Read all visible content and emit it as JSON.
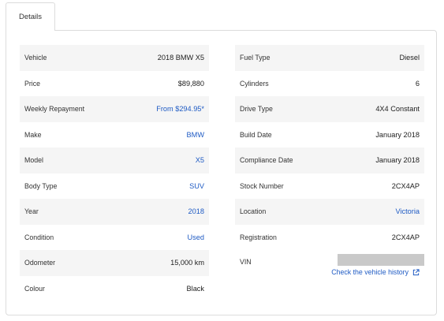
{
  "tab": {
    "label": "Details"
  },
  "left_rows": [
    {
      "label": "Vehicle",
      "value": "2018 BMW X5",
      "link": false
    },
    {
      "label": "Price",
      "value": "$89,880",
      "link": false
    },
    {
      "label": "Weekly Repayment",
      "value": "From $294.95*",
      "link": true
    },
    {
      "label": "Make",
      "value": "BMW",
      "link": true
    },
    {
      "label": "Model",
      "value": "X5",
      "link": true
    },
    {
      "label": "Body Type",
      "value": "SUV",
      "link": true
    },
    {
      "label": "Year",
      "value": "2018",
      "link": true
    },
    {
      "label": "Condition",
      "value": "Used",
      "link": true
    },
    {
      "label": "Odometer",
      "value": "15,000 km",
      "link": false
    },
    {
      "label": "Colour",
      "value": "Black",
      "link": false
    }
  ],
  "right_rows": [
    {
      "label": "Fuel Type",
      "value": "Diesel",
      "link": false
    },
    {
      "label": "Cylinders",
      "value": "6",
      "link": false
    },
    {
      "label": "Drive Type",
      "value": "4X4 Constant",
      "link": false
    },
    {
      "label": "Build Date",
      "value": "January 2018",
      "link": false
    },
    {
      "label": "Compliance Date",
      "value": "January 2018",
      "link": false
    },
    {
      "label": "Stock Number",
      "value": "2CX4AP",
      "link": false
    },
    {
      "label": "Location",
      "value": "Victoria",
      "link": true
    },
    {
      "label": "Registration",
      "value": "2CX4AP",
      "link": false
    }
  ],
  "vin": {
    "label": "VIN",
    "history_link": "Check the vehicle history",
    "icon": "external-link-icon"
  },
  "colors": {
    "link": "#1f5bc4",
    "shade": "#f5f5f5",
    "vin_mask": "#c9c9c9"
  }
}
